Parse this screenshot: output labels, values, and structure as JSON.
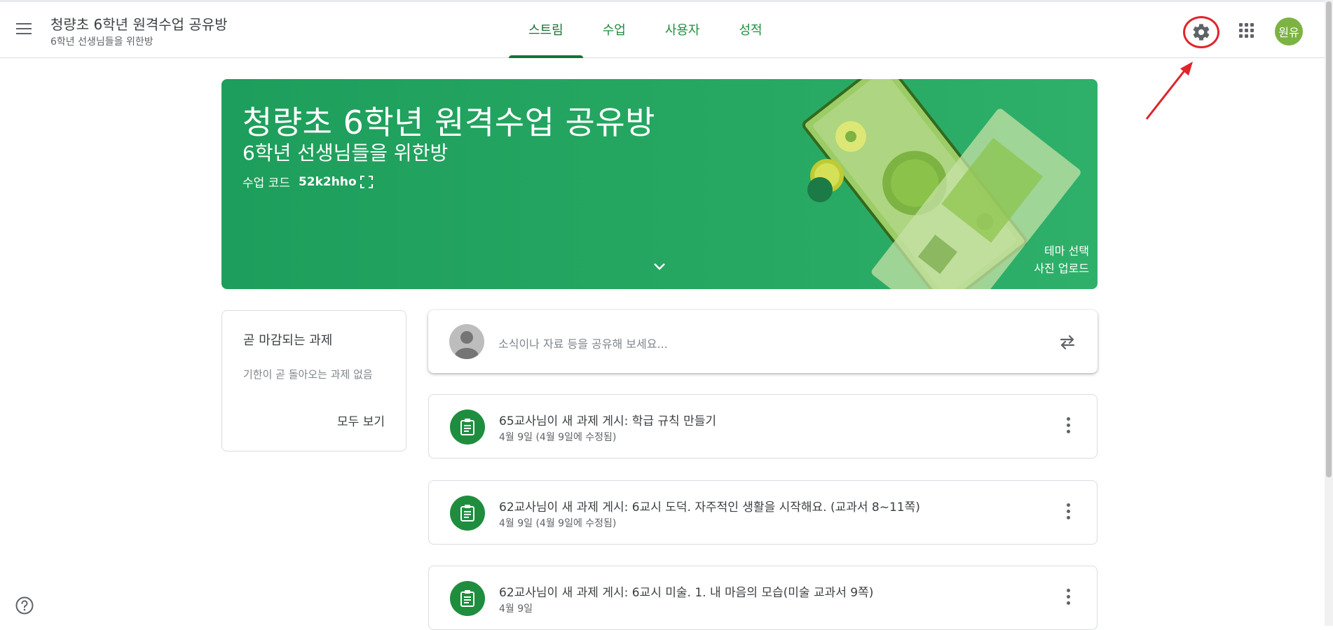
{
  "header": {
    "class_title": "청량초 6학년 원격수업 공유방",
    "class_subtitle": "6학년 선생님들을 위한방",
    "tabs": [
      {
        "label": "스트림",
        "active": true
      },
      {
        "label": "수업",
        "active": false
      },
      {
        "label": "사용자",
        "active": false
      },
      {
        "label": "성적",
        "active": false
      }
    ],
    "avatar_label": "원유",
    "avatar_color": "#7cb342",
    "icons": {
      "menu": "hamburger-menu-icon",
      "settings": "gear-icon",
      "apps": "grid-apps-icon"
    }
  },
  "banner": {
    "title": "청량초 6학년 원격수업 공유방",
    "subtitle": "6학년 선생님들을 위한방",
    "code_label": "수업 코드",
    "code_value": "52k2hho",
    "select_theme": "테마 선택",
    "upload_photo": "사진 업로드",
    "color": "#1e9e5c"
  },
  "upcoming": {
    "title": "곧 마감되는 과제",
    "empty_text": "기한이 곧 돌아오는 과제 없음",
    "view_all": "모두 보기"
  },
  "share": {
    "placeholder": "소식이나 자료 등을 공유해 보세요..."
  },
  "posts": [
    {
      "title": "65교사님이 새 과제 게시: 학급 규칙 만들기",
      "date": "4월 9일 (4월 9일에 수정됨)"
    },
    {
      "title": "62교사님이 새 과제 게시: 6교시 도덕. 자주적인 생활을 시작해요. (교과서 8~11쪽)",
      "date": "4월 9일 (4월 9일에 수정됨)"
    },
    {
      "title": "62교사님이 새 과제 게시: 6교시 미술. 1. 내 마음의 모습(미술 교과서 9쪽)",
      "date": "4월 9일"
    }
  ],
  "accent_color": "#1e8e3e",
  "annotation_color": "#e0242a"
}
